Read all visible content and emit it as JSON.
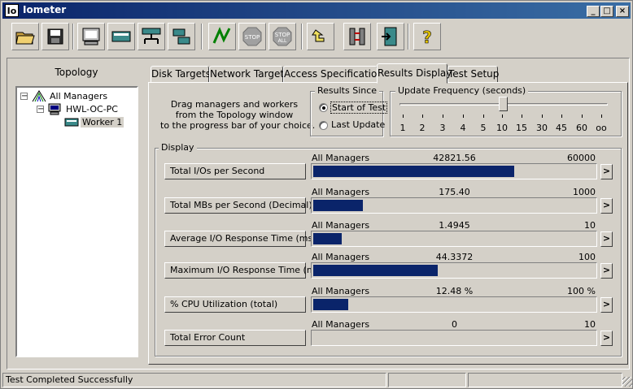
{
  "window": {
    "title": "Iometer",
    "logo": "Io"
  },
  "toolbar": {
    "icons": [
      "open-folder-icon",
      "save-icon",
      "display-icon",
      "manager-icon",
      "worker-icon",
      "disk-workers-icon",
      "start-icon",
      "stop-icon",
      "stop-all-icon",
      "reset-icon",
      "network-icon",
      "exit-icon",
      "help-icon"
    ]
  },
  "topology": {
    "heading": "Topology",
    "root": "All Managers",
    "manager": "HWL-OC-PC",
    "worker": "Worker 1"
  },
  "tabs": [
    "Disk Targets",
    "Network Targets",
    "Access Specifications",
    "Results Display",
    "Test Setup"
  ],
  "instructions": {
    "line1": "Drag managers and workers",
    "line2": "from the Topology window",
    "line3": "to the progress bar of your choice."
  },
  "results_since": {
    "title": "Results Since",
    "option1": "Start of Test",
    "option2": "Last Update",
    "selected": "Start of Test"
  },
  "update_frequency": {
    "title": "Update Frequency (seconds)",
    "ticks": [
      "1",
      "2",
      "3",
      "4",
      "5",
      "10",
      "15",
      "30",
      "45",
      "60",
      "oo"
    ],
    "selected": "10"
  },
  "display": {
    "title": "Display",
    "metrics": [
      {
        "label": "Total I/Os per Second",
        "source": "All Managers",
        "value": "42821.56",
        "max": "60000",
        "fraction": 0.7137
      },
      {
        "label": "Total MBs per Second (Decimal)",
        "source": "All Managers",
        "value": "175.40",
        "max": "1000",
        "fraction": 0.1754
      },
      {
        "label": "Average I/O Response Time (ms)",
        "source": "All Managers",
        "value": "1.4945",
        "max": "10",
        "fraction": 0.1
      },
      {
        "label": "Maximum I/O Response Time (ms)",
        "source": "All Managers",
        "value": "44.3372",
        "max": "100",
        "fraction": 0.4434
      },
      {
        "label": "% CPU Utilization (total)",
        "source": "All Managers",
        "value": "12.48 %",
        "max": "100 %",
        "fraction": 0.1248
      },
      {
        "label": "Total Error Count",
        "source": "All Managers",
        "value": "0",
        "max": "10",
        "fraction": 0
      }
    ],
    "arrow": ">"
  },
  "status": {
    "text": "Test Completed Successfully"
  },
  "colors": {
    "bar_fill": "#0a246a",
    "title_start": "#0a246a",
    "title_end": "#3a6ea5"
  }
}
